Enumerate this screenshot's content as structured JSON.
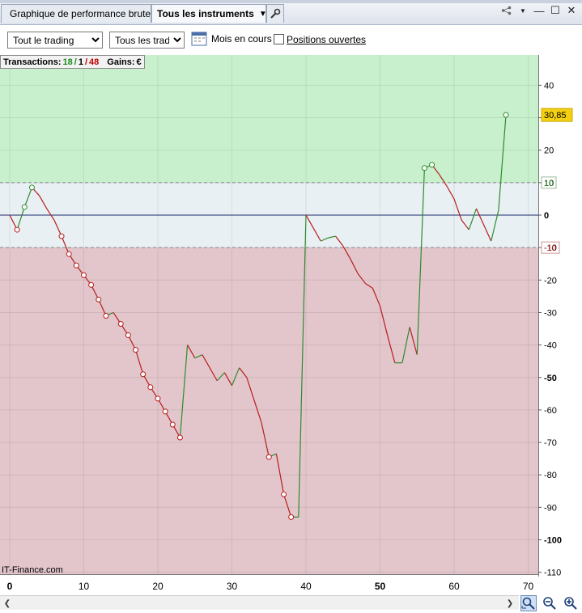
{
  "tabs": {
    "perf_label": "Graphique de performance brute",
    "instruments_label": "Tous les instruments"
  },
  "toolbar": {
    "trading_select": "Tout le trading",
    "trades_select": "Tous les trades",
    "mois_label": "Mois en cours",
    "positions_label": "Positions ouvertes"
  },
  "info": {
    "transactions_label": "Transactions:",
    "wins": "18",
    "sep1": "/",
    "neutral": "1",
    "sep2": "/",
    "losses": "48",
    "gains_label": "Gains:",
    "gains_unit": "€"
  },
  "credit": "IT-Finance.com",
  "colors": {
    "profit_zone": "#c8f0cc",
    "neutral_zone": "#e8f0f4",
    "loss_zone": "#e2c6cb",
    "up_line": "#2e8b2e",
    "down_line": "#b81d1d",
    "last_badge": "#f5d010"
  },
  "chart_data": {
    "type": "line",
    "ylim": [
      -112,
      50
    ],
    "xlim": [
      -1,
      71
    ],
    "yticks": [
      40,
      30,
      20,
      10,
      0,
      -10,
      -20,
      -30,
      -40,
      -50,
      -60,
      -70,
      -80,
      -90,
      -100,
      -110
    ],
    "ytick_labels": [
      "40",
      "",
      "20",
      "10",
      "0",
      "-10",
      "-20",
      "-30",
      "-40",
      "-50",
      "-60",
      "-70",
      "-80",
      "-90",
      "-100",
      "-110"
    ],
    "bold_yticks": [
      "0",
      "-50",
      "-100"
    ],
    "xticks": [
      0,
      10,
      20,
      30,
      40,
      50,
      60,
      70
    ],
    "bold_xticks": [
      "0",
      "50"
    ],
    "upper_band": 10,
    "lower_band": -10,
    "last_value": "30,85",
    "points": [
      [
        0,
        0
      ],
      [
        1,
        -4.5
      ],
      [
        2,
        2.5
      ],
      [
        3,
        8.5
      ],
      [
        4,
        6
      ],
      [
        5,
        2
      ],
      [
        6,
        -1.5
      ],
      [
        7,
        -6.5
      ],
      [
        8,
        -12
      ],
      [
        9,
        -15.5
      ],
      [
        10,
        -18.5
      ],
      [
        11,
        -21.5
      ],
      [
        12,
        -26
      ],
      [
        13,
        -31
      ],
      [
        14,
        -30
      ],
      [
        15,
        -33.5
      ],
      [
        16,
        -37
      ],
      [
        17,
        -41.5
      ],
      [
        18,
        -49
      ],
      [
        19,
        -53
      ],
      [
        20,
        -56.5
      ],
      [
        21,
        -60.5
      ],
      [
        22,
        -64.5
      ],
      [
        23,
        -68.5
      ],
      [
        24,
        -40
      ],
      [
        25,
        -44
      ],
      [
        26,
        -43
      ],
      [
        27,
        -47
      ],
      [
        28,
        -51
      ],
      [
        29,
        -48.5
      ],
      [
        30,
        -52.5
      ],
      [
        31,
        -47
      ],
      [
        32,
        -50
      ],
      [
        33,
        -57
      ],
      [
        34,
        -64
      ],
      [
        35,
        -74.5
      ],
      [
        36,
        -73.5
      ],
      [
        37,
        -86
      ],
      [
        38,
        -93
      ],
      [
        39,
        -93
      ],
      [
        40,
        0
      ],
      [
        41,
        -4
      ],
      [
        42,
        -8
      ],
      [
        43,
        -7
      ],
      [
        44,
        -6.5
      ],
      [
        45,
        -9.5
      ],
      [
        46,
        -13.5
      ],
      [
        47,
        -18
      ],
      [
        48,
        -21
      ],
      [
        49,
        -22.5
      ],
      [
        50,
        -28
      ],
      [
        51,
        -37
      ],
      [
        52,
        -45.5
      ],
      [
        53,
        -45.5
      ],
      [
        54,
        -34.5
      ],
      [
        55,
        -43
      ],
      [
        56,
        14.5
      ],
      [
        57,
        15.5
      ],
      [
        58,
        12.5
      ],
      [
        59,
        9
      ],
      [
        60,
        5
      ],
      [
        61,
        -1.5
      ],
      [
        62,
        -4.5
      ],
      [
        63,
        2
      ],
      [
        64,
        -3
      ],
      [
        65,
        -8
      ],
      [
        66,
        1.5
      ],
      [
        67,
        30.85
      ]
    ],
    "marked_x": [
      1,
      2,
      3,
      7,
      8,
      9,
      10,
      11,
      12,
      13,
      15,
      16,
      17,
      18,
      19,
      20,
      21,
      22,
      23,
      35,
      37,
      38,
      56,
      57,
      67
    ]
  }
}
